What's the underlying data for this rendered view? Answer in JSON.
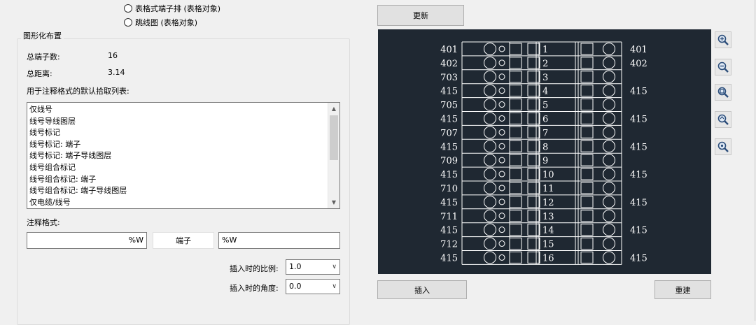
{
  "options": {
    "table_terminal": "表格式端子排 (表格对象)",
    "jumper_diagram": "跳线图 (表格对象)"
  },
  "layout_group": {
    "title": "图形化布置",
    "total_terminals_label": "总端子数:",
    "total_terminals_value": "16",
    "total_distance_label": "总距离:",
    "total_distance_value": "3.14",
    "pick_list_label": "用于注释格式的默认拾取列表:",
    "pick_list": [
      "仅线号",
      "线号导线图层",
      "线号标记",
      "线号标记: 端子",
      "线号标记: 端子导线图层",
      "线号组合标记",
      "线号组合标记: 端子",
      "线号组合标记: 端子导线图层",
      "仅电缆/线号",
      "电缆/线号导线图层"
    ],
    "annotation_label": "注释格式:",
    "annotation_left": "%W",
    "annotation_center": "端子",
    "annotation_right": "%W",
    "scale_label": "插入时的比例:",
    "scale_value": "1.0",
    "angle_label": "插入时的角度:",
    "angle_value": "0.0"
  },
  "buttons": {
    "update": "更新",
    "insert": "插入",
    "rebuild": "重建"
  },
  "preview": {
    "rows": [
      {
        "left": "401",
        "num": "1",
        "right": "401"
      },
      {
        "left": "402",
        "num": "2",
        "right": "402"
      },
      {
        "left": "703",
        "num": "3",
        "right": ""
      },
      {
        "left": "415",
        "num": "4",
        "right": "415"
      },
      {
        "left": "705",
        "num": "5",
        "right": ""
      },
      {
        "left": "415",
        "num": "6",
        "right": "415"
      },
      {
        "left": "707",
        "num": "7",
        "right": ""
      },
      {
        "left": "415",
        "num": "8",
        "right": "415"
      },
      {
        "left": "709",
        "num": "9",
        "right": ""
      },
      {
        "left": "415",
        "num": "10",
        "right": "415"
      },
      {
        "left": "710",
        "num": "11",
        "right": ""
      },
      {
        "left": "415",
        "num": "12",
        "right": "415"
      },
      {
        "left": "711",
        "num": "13",
        "right": ""
      },
      {
        "left": "415",
        "num": "14",
        "right": "415"
      },
      {
        "left": "712",
        "num": "15",
        "right": ""
      },
      {
        "left": "415",
        "num": "16",
        "right": "415"
      }
    ]
  },
  "zoom_tools": [
    "zoom-in-icon",
    "zoom-out-icon",
    "zoom-window-icon",
    "zoom-previous-icon",
    "zoom-extents-icon"
  ],
  "colors": {
    "canvas_bg": "#1f2832",
    "preview_line": "#ffffff"
  }
}
